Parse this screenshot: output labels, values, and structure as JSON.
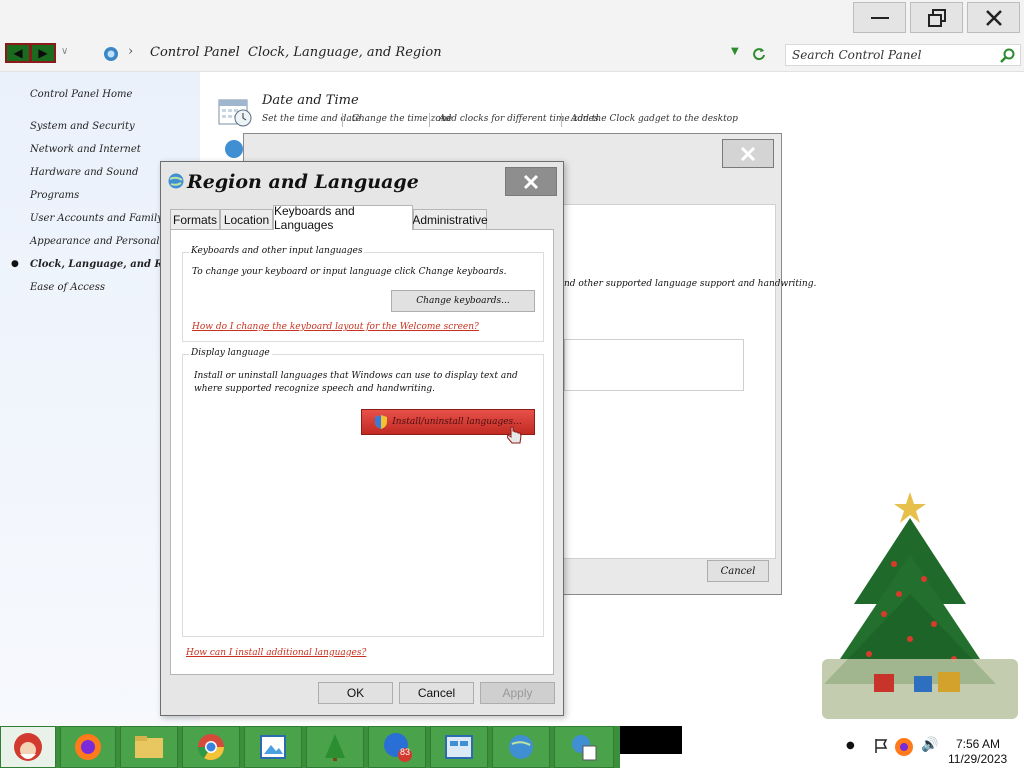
{
  "breadcrumb": [
    "Control Panel",
    "Clock, Language, and Region"
  ],
  "search": {
    "placeholder": "Search Control Panel"
  },
  "leftnav": {
    "home": "Control Panel Home",
    "items": [
      "System and Security",
      "Network and Internet",
      "Hardware and Sound",
      "Programs",
      "User Accounts and Family Safety",
      "Appearance and Personalization",
      "Clock, Language, and Region",
      "Ease of Access"
    ]
  },
  "content": {
    "date_time": {
      "title": "Date and Time",
      "links": [
        "Set the time and date",
        "Change the time zone",
        "Add clocks for different time zones",
        "Add the Clock gadget to the desktop"
      ]
    }
  },
  "bg_dialog": {
    "text_fragment": "nd other supported language support and handwriting.",
    "cancel": "Cancel"
  },
  "dialog": {
    "title": "Region and Language",
    "tabs": [
      "Formats",
      "Location",
      "Keyboards and Languages",
      "Administrative"
    ],
    "active_tab": "Keyboards and Languages",
    "kb_group": {
      "title": "Keyboards and other input languages",
      "text": "To change your keyboard or input language click Change keyboards.",
      "button": "Change keyboards...",
      "link": "How do I change the keyboard layout for the Welcome screen?"
    },
    "display_group": {
      "title": "Display language",
      "text": "Install or uninstall languages that Windows can use to display text and where supported recognize speech and handwriting.",
      "button": "Install/uninstall languages..."
    },
    "bottom_link": "How can I install additional languages?",
    "ok": "OK",
    "cancel": "Cancel",
    "apply": "Apply"
  },
  "taskbar": {
    "badge_count": "83",
    "time": "7:56 AM",
    "date": "11/29/2023"
  },
  "colors": {
    "accent_red": "#d23a2f",
    "link_red": "#c8311f",
    "taskbar_green": "#4aa24a"
  }
}
